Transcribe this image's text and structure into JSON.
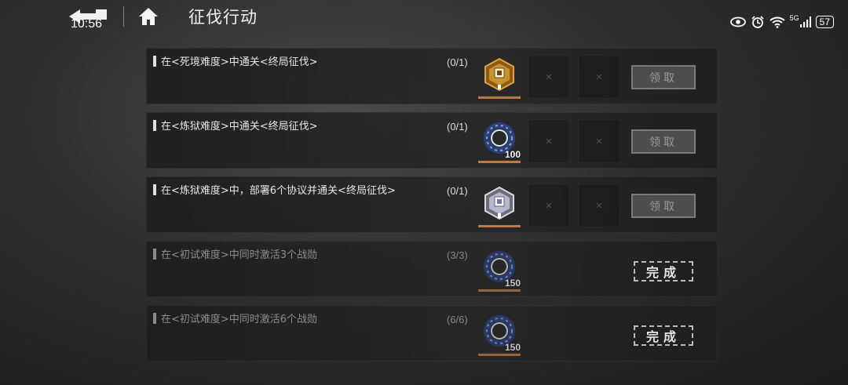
{
  "status_bar": {
    "time": "10:56",
    "battery": "57",
    "network": "5G"
  },
  "header": {
    "title": "征伐行动"
  },
  "quests": [
    {
      "desc": "在<死境难度>中通关<终局征伐>",
      "progress": "(0/1)",
      "reward_icon": "gold-hex-badge-icon",
      "reward_qty": "",
      "action": "领取",
      "state": "claimable"
    },
    {
      "desc": "在<炼狱难度>中通关<终局征伐>",
      "progress": "(0/1)",
      "reward_icon": "blue-ring-icon",
      "reward_qty": "100",
      "action": "领取",
      "state": "claimable"
    },
    {
      "desc": "在<炼狱难度>中，部署6个协议并通关<终局征伐>",
      "progress": "(0/1)",
      "reward_icon": "silver-hex-badge-icon",
      "reward_qty": "",
      "action": "领取",
      "state": "claimable"
    },
    {
      "desc": "在<初试难度>中同时激活3个战勋",
      "progress": "(3/3)",
      "reward_icon": "blue-ring-icon",
      "reward_qty": "150",
      "action": "完成",
      "state": "done"
    },
    {
      "desc": "在<初试难度>中同时激活6个战勋",
      "progress": "(6/6)",
      "reward_icon": "blue-ring-icon",
      "reward_qty": "150",
      "action": "完成",
      "state": "done"
    }
  ],
  "colors": {
    "accent_orange": "#d9731f",
    "gold": "#c9922c",
    "ring_blue": "#3c5aa8"
  }
}
